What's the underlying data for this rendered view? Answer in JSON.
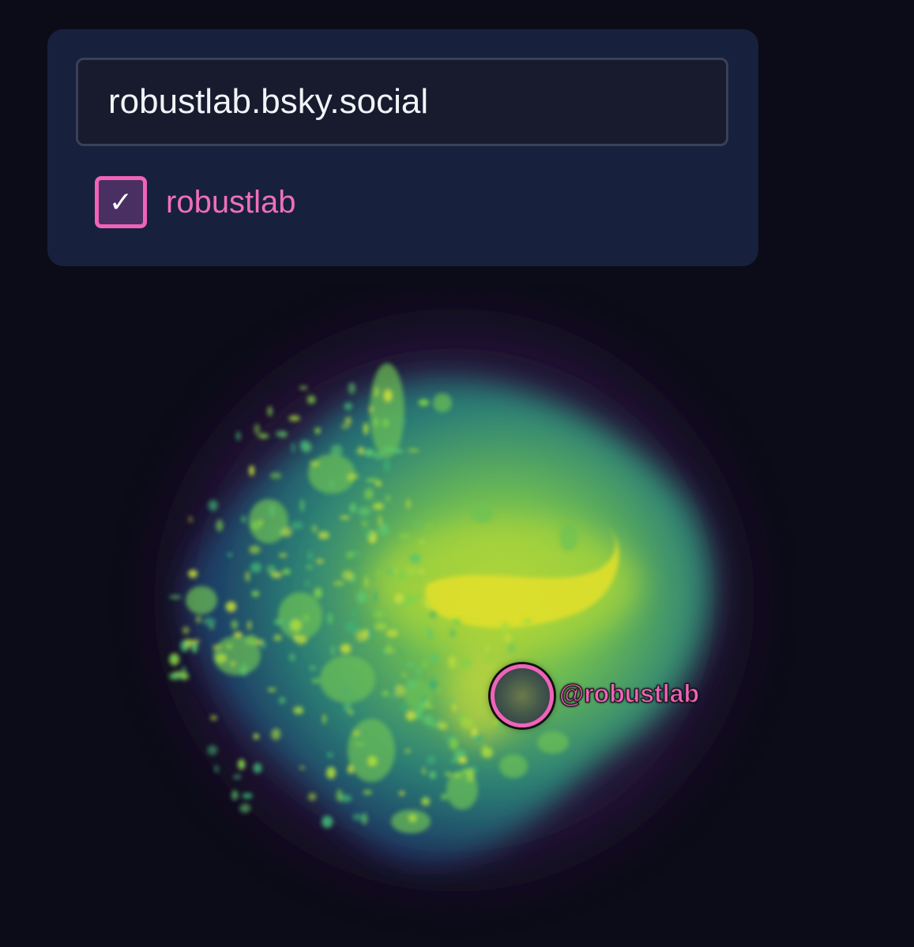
{
  "search": {
    "value": "robustlab.bsky.social"
  },
  "filter": {
    "checked": true,
    "check_glyph": "✓",
    "label": "robustlab"
  },
  "map": {
    "colors": {
      "halo": "#2a1440",
      "base": "#1d4c6a",
      "mid": "#2f9a7a",
      "bright": "#8fd24a",
      "hot": "#e2e22a"
    },
    "marker": {
      "label": "@robustlab",
      "ring_color": "#f063b8"
    }
  }
}
